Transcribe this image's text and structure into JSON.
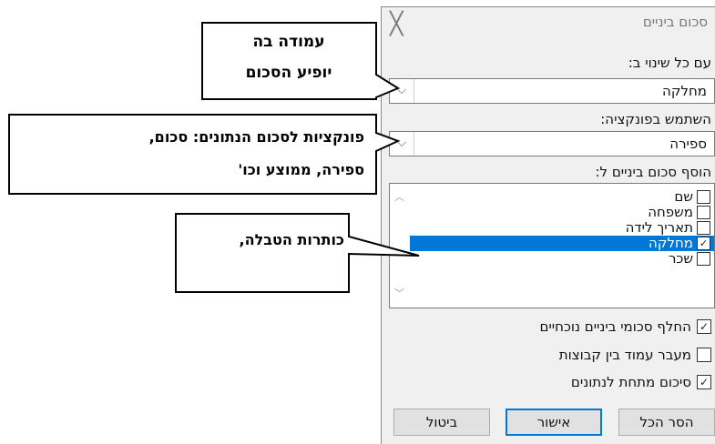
{
  "dialog": {
    "title": "סכום ביניים",
    "close_glyph": "╳",
    "at_each_change_label": "עם כל שינוי ב:",
    "at_each_change_value": "מחלקה",
    "use_function_label": "השתמש בפונקציה:",
    "use_function_value": "ספירה",
    "add_subtotal_label": "הוסף סכום ביניים ל:",
    "columns": [
      {
        "label": "שם",
        "checked": false
      },
      {
        "label": "משפחה",
        "checked": false
      },
      {
        "label": "תאריך לידה",
        "checked": false
      },
      {
        "label": "מחלקה",
        "checked": true
      },
      {
        "label": "שכר",
        "checked": false
      }
    ],
    "options": [
      {
        "label": "החלף סכומי ביניים נוכחיים",
        "checked": true
      },
      {
        "label": "מעבר עמוד בין קבוצות",
        "checked": false
      },
      {
        "label": "סיכום מתחת לנתונים",
        "checked": true
      }
    ],
    "buttons": {
      "remove_all": "הסר הכל",
      "ok": "אישור",
      "cancel": "ביטול"
    }
  },
  "callouts": {
    "column_line1": "עמודה בה",
    "column_line2": "יופיע הסכום",
    "function_line1": "פונקציות לסכום הנתונים: סכום,",
    "function_line2": "ספירה, ממוצע וכו'",
    "headers": "כותרות הטבלה,"
  }
}
